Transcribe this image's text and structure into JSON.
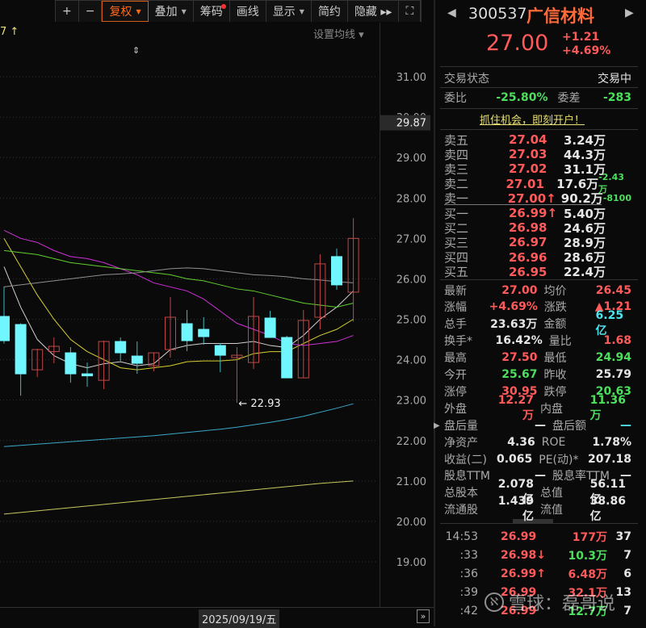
{
  "toolbar": {
    "zoom_in": "+",
    "zoom_out": "−",
    "fuquan": "复权",
    "overlay": "叠加",
    "chips": "筹码",
    "draw": "画线",
    "display": "显示",
    "simple": "简约",
    "hide": "隐藏 ▸▸",
    "fullscreen": "⛶"
  },
  "chart_header": {
    "ma_partial": "7 ↑",
    "set_ma": "设置均线 ▾"
  },
  "price_axis": {
    "ticks": [
      "31.00",
      "30.00",
      "29.00",
      "28.00",
      "27.00",
      "26.00",
      "25.00",
      "24.00",
      "23.00",
      "22.00",
      "21.00",
      "20.00",
      "19.00"
    ],
    "current": "29.87"
  },
  "chart_data": {
    "type": "candlestick",
    "ylim": [
      19,
      31
    ],
    "low_annotation": "22.93",
    "candles": [
      {
        "o": 25.07,
        "c": 24.47,
        "h": 25.81,
        "l": 24.4
      },
      {
        "o": 24.87,
        "c": 23.65,
        "h": 24.9,
        "l": 23.11
      },
      {
        "o": 23.75,
        "c": 24.25,
        "h": 24.27,
        "l": 23.57
      },
      {
        "o": 24.2,
        "c": 24.33,
        "h": 24.55,
        "l": 23.91
      },
      {
        "o": 24.17,
        "c": 23.65,
        "h": 24.31,
        "l": 23.43
      },
      {
        "o": 23.65,
        "c": 23.6,
        "h": 23.93,
        "l": 23.33
      },
      {
        "o": 23.49,
        "c": 24.45,
        "h": 24.47,
        "l": 23.27
      },
      {
        "o": 24.45,
        "c": 24.17,
        "h": 24.55,
        "l": 23.97
      },
      {
        "o": 24.09,
        "c": 23.91,
        "h": 24.45,
        "l": 23.65
      },
      {
        "o": 23.85,
        "c": 24.17,
        "h": 24.17,
        "l": 23.71
      },
      {
        "o": 24.25,
        "c": 25.05,
        "h": 25.55,
        "l": 24.05
      },
      {
        "o": 24.89,
        "c": 24.47,
        "h": 25.23,
        "l": 24.21
      },
      {
        "o": 24.75,
        "c": 24.57,
        "h": 25.05,
        "l": 24.37
      },
      {
        "o": 24.35,
        "c": 24.11,
        "h": 24.41,
        "l": 23.69
      },
      {
        "o": 24.05,
        "c": 24.11,
        "h": 24.31,
        "l": 22.93
      },
      {
        "o": 23.93,
        "c": 25.07,
        "h": 25.55,
        "l": 23.77
      },
      {
        "o": 25.03,
        "c": 24.55,
        "h": 25.21,
        "l": 24.55
      },
      {
        "o": 24.55,
        "c": 23.55,
        "h": 24.59,
        "l": 23.55
      },
      {
        "o": 23.55,
        "c": 24.97,
        "h": 25.23,
        "l": 23.55
      },
      {
        "o": 25.05,
        "c": 26.37,
        "h": 26.61,
        "l": 24.75
      },
      {
        "o": 26.55,
        "c": 25.85,
        "h": 26.75,
        "l": 25.73
      },
      {
        "o": 25.67,
        "c": 27.0,
        "h": 27.5,
        "l": 24.94
      }
    ],
    "ma_series": [
      {
        "name": "MA5",
        "color": "#d0d0d0",
        "values": [
          26.3,
          25.3,
          24.5,
          24.1,
          23.9,
          23.8,
          23.9,
          23.95,
          23.85,
          23.9,
          24.25,
          24.35,
          24.4,
          24.4,
          24.4,
          24.45,
          24.35,
          24.3,
          24.6,
          25.0,
          25.3,
          25.7
        ]
      },
      {
        "name": "MA10",
        "color": "#d8d030",
        "values": [
          27.0,
          26.3,
          25.6,
          25.0,
          24.5,
          24.2,
          24.0,
          23.8,
          23.75,
          23.8,
          23.85,
          23.95,
          23.97,
          23.97,
          24.0,
          24.15,
          24.2,
          24.2,
          24.4,
          24.6,
          24.75,
          25.0
        ]
      },
      {
        "name": "MA20",
        "color": "#d030d8",
        "values": [
          27.2,
          27.0,
          26.9,
          26.7,
          26.55,
          26.5,
          26.4,
          26.25,
          26.1,
          25.9,
          25.8,
          25.7,
          25.5,
          25.2,
          24.9,
          24.75,
          24.6,
          24.4,
          24.35,
          24.4,
          24.45,
          24.6
        ]
      },
      {
        "name": "MA30",
        "color": "#60d030",
        "values": [
          26.7,
          26.65,
          26.6,
          26.5,
          26.4,
          26.35,
          26.3,
          26.25,
          26.2,
          26.15,
          26.1,
          26.0,
          25.95,
          25.85,
          25.75,
          25.7,
          25.6,
          25.5,
          25.4,
          25.35,
          25.3,
          25.4
        ]
      },
      {
        "name": "MA60",
        "color": "#909090",
        "values": [
          25.8,
          25.85,
          25.9,
          25.95,
          26.0,
          26.05,
          26.1,
          26.12,
          26.15,
          26.2,
          26.25,
          26.27,
          26.25,
          26.2,
          26.15,
          26.1,
          26.08,
          26.05,
          26.0,
          25.97,
          25.93,
          25.9
        ]
      },
      {
        "name": "MA120",
        "color": "#3aa8c8",
        "values": [
          21.85,
          21.88,
          21.91,
          21.94,
          21.97,
          22.0,
          22.03,
          22.06,
          22.09,
          22.12,
          22.16,
          22.2,
          22.24,
          22.28,
          22.33,
          22.39,
          22.45,
          22.52,
          22.6,
          22.7,
          22.8,
          22.91
        ]
      },
      {
        "name": "MA250",
        "color": "#c8c860",
        "values": [
          20.18,
          20.22,
          20.26,
          20.3,
          20.34,
          20.38,
          20.42,
          20.46,
          20.5,
          20.54,
          20.58,
          20.62,
          20.66,
          20.7,
          20.74,
          20.78,
          20.82,
          20.86,
          20.9,
          20.94,
          20.97,
          21.0
        ]
      }
    ],
    "colors": {
      "up": "#e05050",
      "down": "#6ff6ff"
    }
  },
  "date_bar": {
    "date": "2025/09/19/五",
    "next": "»"
  },
  "quote": {
    "code": "300537",
    "name": "广信材料",
    "price": "27.00",
    "change": "+1.21",
    "change_pct": "+4.69%",
    "status_label": "交易状态",
    "status": "交易中",
    "wb_label": "委比",
    "wb": "-25.80%",
    "wc_label": "委差",
    "wc": "-283",
    "promo": "抓住机会，即刻开户！"
  },
  "order_book": [
    {
      "label": "卖五",
      "price": "27.04",
      "vol": "3.24万",
      "chg": ""
    },
    {
      "label": "卖四",
      "price": "27.03",
      "vol": "44.3万",
      "chg": ""
    },
    {
      "label": "卖三",
      "price": "27.02",
      "vol": "31.1万",
      "chg": ""
    },
    {
      "label": "卖二",
      "price": "27.01",
      "vol": "17.6万",
      "chg": "-2.43万"
    },
    {
      "label": "卖一",
      "price": "27.00↑",
      "vol": "90.2万",
      "chg": "-8100"
    },
    {
      "label": "买一",
      "price": "26.99↑",
      "vol": "5.40万",
      "chg": ""
    },
    {
      "label": "买二",
      "price": "26.98",
      "vol": "24.6万",
      "chg": ""
    },
    {
      "label": "买三",
      "price": "26.97",
      "vol": "28.9万",
      "chg": ""
    },
    {
      "label": "买四",
      "price": "26.96",
      "vol": "28.6万",
      "chg": ""
    },
    {
      "label": "买五",
      "price": "26.95",
      "vol": "22.4万",
      "chg": ""
    }
  ],
  "stats": [
    [
      "最新",
      "27.00",
      "red",
      "均价",
      "26.45",
      "red"
    ],
    [
      "涨幅",
      "+4.69%",
      "red",
      "涨跌",
      "▲1.21",
      "red"
    ],
    [
      "总手",
      "23.63万",
      "white",
      "金额",
      "6.25亿",
      "cyan"
    ],
    [
      "换手*",
      "16.42%",
      "white",
      "量比",
      "1.68",
      "red"
    ],
    [
      "最高",
      "27.50",
      "red",
      "最低",
      "24.94",
      "green"
    ],
    [
      "今开",
      "25.67",
      "green",
      "昨收",
      "25.79",
      "white"
    ],
    [
      "涨停",
      "30.95",
      "red",
      "跌停",
      "20.63",
      "green"
    ],
    [
      "外盘",
      "12.27万",
      "red",
      "内盘",
      "11.36万",
      "green"
    ],
    [
      "盘后量",
      "—",
      "white",
      "盘后额",
      "—",
      "cyan"
    ],
    [
      "净资产",
      "4.36",
      "white",
      "ROE",
      "1.78%",
      "white"
    ],
    [
      "收益(二)",
      "0.065",
      "white",
      "PE(动)*",
      "207.18",
      "white"
    ],
    [
      "股息TTM",
      "—",
      "white",
      "股息率TTM",
      "—",
      "white"
    ],
    [
      "总股本",
      "2.078亿",
      "white",
      "总值",
      "56.11亿",
      "white"
    ],
    [
      "流通股",
      "1.439亿",
      "white",
      "流值",
      "38.86亿",
      "white"
    ]
  ],
  "ticks": [
    {
      "time": "14:53",
      "price": "26.99",
      "pc": "red",
      "vol": "177万",
      "vc": "red",
      "n": "37"
    },
    {
      "time": ":33",
      "price": "26.98↓",
      "pc": "red",
      "vol": "10.3万",
      "vc": "green",
      "n": "7"
    },
    {
      "time": ":36",
      "price": "26.99↑",
      "pc": "red",
      "vol": "6.48万",
      "vc": "red",
      "n": "6"
    },
    {
      "time": ":39",
      "price": "26.99",
      "pc": "red",
      "vol": "32.1万",
      "vc": "red",
      "n": "13"
    },
    {
      "time": ":42",
      "price": "26.99",
      "pc": "red",
      "vol": "12.7万",
      "vc": "green",
      "n": "7"
    }
  ],
  "watermark": "雪球：磊哥说"
}
